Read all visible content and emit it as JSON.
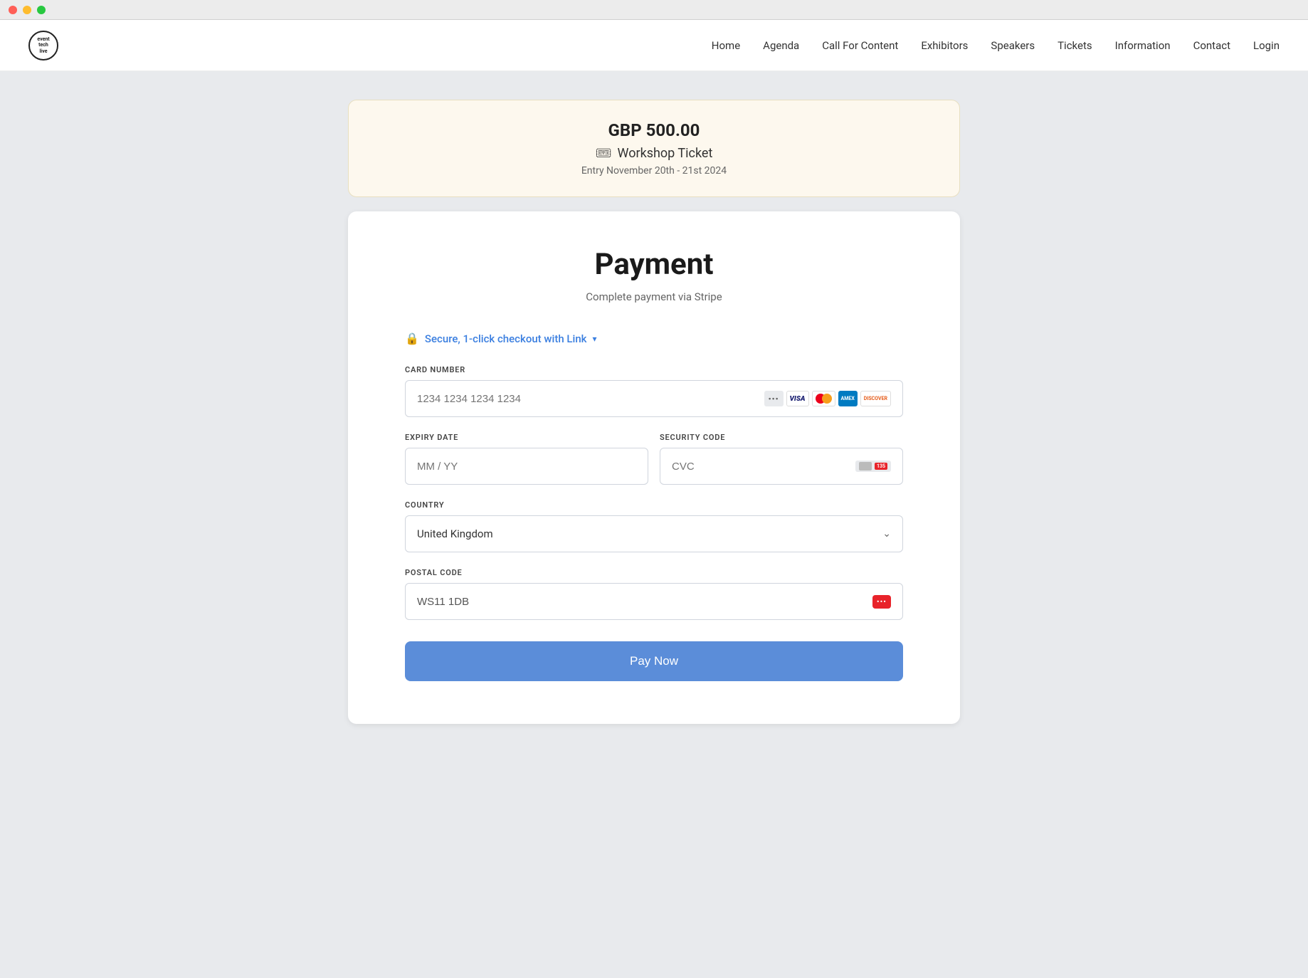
{
  "titlebar": {
    "buttons": [
      "close",
      "minimize",
      "maximize"
    ]
  },
  "nav": {
    "logo": {
      "circle_text": "event\ntech\nlive",
      "alt": "Event Tech Live"
    },
    "links": [
      {
        "label": "Home",
        "href": "#"
      },
      {
        "label": "Agenda",
        "href": "#"
      },
      {
        "label": "Call For Content",
        "href": "#"
      },
      {
        "label": "Exhibitors",
        "href": "#"
      },
      {
        "label": "Speakers",
        "href": "#"
      },
      {
        "label": "Tickets",
        "href": "#"
      },
      {
        "label": "Information",
        "href": "#"
      },
      {
        "label": "Contact",
        "href": "#"
      },
      {
        "label": "Login",
        "href": "#"
      }
    ]
  },
  "ticket": {
    "price": "GBP 500.00",
    "name": "Workshop Ticket",
    "dates": "Entry November 20th - 21st 2024"
  },
  "payment": {
    "title": "Payment",
    "subtitle": "Complete payment via Stripe",
    "secure_checkout_label": "Secure, 1-click checkout with Link",
    "fields": {
      "card_number": {
        "label": "CARD NUMBER",
        "placeholder": "1234 1234 1234 1234"
      },
      "expiry": {
        "label": "EXPIRY DATE",
        "placeholder": "MM / YY"
      },
      "security_code": {
        "label": "SECURITY CODE",
        "placeholder": "CVC"
      },
      "country": {
        "label": "COUNTRY",
        "value": "United Kingdom"
      },
      "postal_code": {
        "label": "POSTAL CODE",
        "value": "WS11 1DB"
      }
    },
    "pay_button_label": "Pay Now"
  }
}
